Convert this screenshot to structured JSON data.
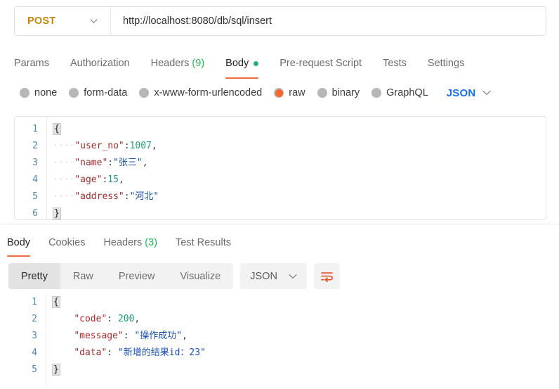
{
  "request": {
    "method": "POST",
    "method_chevron_icon": "chevron-down-icon",
    "url": "http://localhost:8080/db/sql/insert",
    "url_placeholder": "Enter request URL",
    "tabs": [
      {
        "label": "Params",
        "active": false
      },
      {
        "label": "Authorization",
        "active": false
      },
      {
        "label": "Headers",
        "count": "(9)",
        "active": false
      },
      {
        "label": "Body",
        "active": true,
        "has_dot": true
      },
      {
        "label": "Pre-request Script",
        "active": false
      },
      {
        "label": "Tests",
        "active": false
      },
      {
        "label": "Settings",
        "active": false
      }
    ],
    "body_modes": [
      {
        "label": "none",
        "selected": false
      },
      {
        "label": "form-data",
        "selected": false
      },
      {
        "label": "x-www-form-urlencoded",
        "selected": false
      },
      {
        "label": "raw",
        "selected": true
      },
      {
        "label": "binary",
        "selected": false
      },
      {
        "label": "GraphQL",
        "selected": false
      }
    ],
    "body_format": "JSON",
    "body_format_chevron_icon": "chevron-down-icon",
    "editor": {
      "lines": [
        {
          "no": "1",
          "brace": "{",
          "indent": "",
          "key": "",
          "colon": "",
          "value": "",
          "value_type": "",
          "comma": ""
        },
        {
          "no": "2",
          "brace": "",
          "indent": "····",
          "key": "\"user_no\"",
          "colon": ":",
          "value": "1007",
          "value_type": "num",
          "comma": ","
        },
        {
          "no": "3",
          "brace": "",
          "indent": "····",
          "key": "\"name\"",
          "colon": ":",
          "value": "\"张三\"",
          "value_type": "str",
          "comma": ","
        },
        {
          "no": "4",
          "brace": "",
          "indent": "····",
          "key": "\"age\"",
          "colon": ":",
          "value": "15",
          "value_type": "num",
          "comma": ","
        },
        {
          "no": "5",
          "brace": "",
          "indent": "····",
          "key": "\"address\"",
          "colon": ":",
          "value": "\"河北\"",
          "value_type": "str",
          "comma": ""
        },
        {
          "no": "6",
          "brace": "}",
          "indent": "",
          "key": "",
          "colon": "",
          "value": "",
          "value_type": "",
          "comma": ""
        }
      ]
    }
  },
  "response": {
    "tabs": [
      {
        "label": "Body",
        "active": true
      },
      {
        "label": "Cookies",
        "active": false
      },
      {
        "label": "Headers",
        "count": "(3)",
        "active": false
      },
      {
        "label": "Test Results",
        "active": false
      }
    ],
    "view_modes": [
      {
        "label": "Pretty",
        "active": true
      },
      {
        "label": "Raw",
        "active": false
      },
      {
        "label": "Preview",
        "active": false
      },
      {
        "label": "Visualize",
        "active": false
      }
    ],
    "format": "JSON",
    "format_chevron_icon": "chevron-down-icon",
    "wrap_icon": "word-wrap-icon",
    "editor": {
      "lines": [
        {
          "no": "1",
          "brace": "{",
          "indent": "",
          "key": "",
          "colon": "",
          "value": "",
          "value_type": "",
          "comma": ""
        },
        {
          "no": "2",
          "brace": "",
          "indent": "    ",
          "key": "\"code\"",
          "colon": ": ",
          "value": "200",
          "value_type": "num",
          "comma": ","
        },
        {
          "no": "3",
          "brace": "",
          "indent": "    ",
          "key": "\"message\"",
          "colon": ": ",
          "value": "\"操作成功\"",
          "value_type": "str",
          "comma": ","
        },
        {
          "no": "4",
          "brace": "",
          "indent": "    ",
          "key": "\"data\"",
          "colon": ": ",
          "value": "\"新增的结果id：23\"",
          "value_type": "str",
          "comma": ""
        },
        {
          "no": "5",
          "brace": "}",
          "indent": "",
          "key": "",
          "colon": "",
          "value": "",
          "value_type": "",
          "comma": ""
        }
      ]
    }
  },
  "colors": {
    "method": "#c4870d",
    "accent_orange": "#f26b3a",
    "raw_selected": "#f96731",
    "green_count": "#1db954",
    "blue_link": "#1a6ef5",
    "json_key": "#a52a2a",
    "json_num": "#1c9e7a",
    "json_str": "#1a4fb5",
    "gutter": "#4f89b5"
  }
}
